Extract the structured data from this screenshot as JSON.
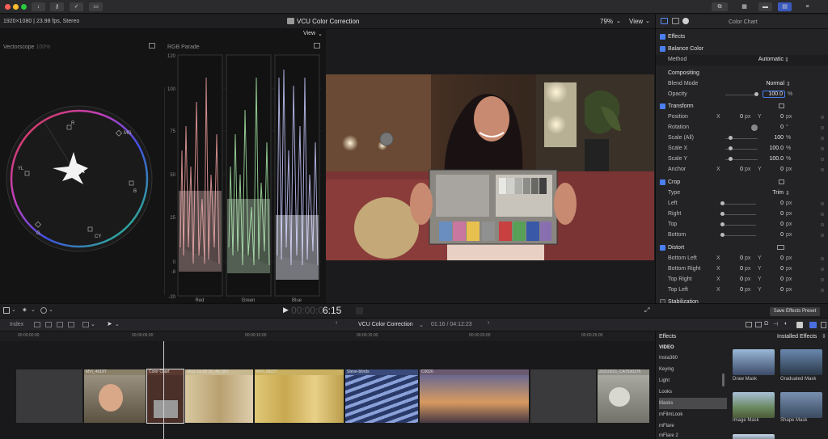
{
  "titlebar": {
    "colors": {
      "close": "#fe5f57",
      "minimize": "#febc2e",
      "zoom": "#28c840"
    },
    "left_buttons": [
      "download-icon",
      "key-icon",
      "check-icon",
      "message-icon"
    ],
    "right_buttons": [
      "clip-icon",
      "grid-icon",
      "browser-icon",
      "inspector-icon",
      "adjust-icon"
    ]
  },
  "viewer": {
    "format": "1920×1080 | 23.98 fps, Stereo",
    "title": "VCU Color Correction",
    "zoom": "79%",
    "view_label": "View",
    "scope_view_label": "View"
  },
  "scopes": {
    "vectorscope_label": "Vectorscope",
    "vectorscope_pct": "100%",
    "targets": [
      "R",
      "MG",
      "B",
      "CY",
      "G",
      "YL"
    ],
    "parade_label": "RGB Parade",
    "parade_ticks": [
      "120",
      "100",
      "75",
      "50",
      "25",
      "0",
      "-8",
      "-20"
    ],
    "parade_channels": [
      "Red",
      "Green",
      "Blue"
    ]
  },
  "inspector": {
    "title": "Color Chart",
    "effects_label": "Effects",
    "balance_color": "Balance Color",
    "method_label": "Method",
    "method_value": "Automatic",
    "compositing": "Compositing",
    "blend_mode_label": "Blend Mode",
    "blend_mode_value": "Normal",
    "opacity_label": "Opacity",
    "opacity_value": "100.0",
    "pct": "%",
    "transform": "Transform",
    "position_label": "Position",
    "rotation_label": "Rotation",
    "scale_all_label": "Scale (All)",
    "scale_x_label": "Scale X",
    "scale_y_label": "Scale Y",
    "anchor_label": "Anchor",
    "x": "X",
    "y": "Y",
    "px": "px",
    "deg": "°",
    "zero": "0",
    "hundred": "100",
    "hundred_dec": "100.0",
    "crop": "Crop",
    "type_label": "Type",
    "type_value": "Trim",
    "left_label": "Left",
    "right_label": "Right",
    "top_label": "Top",
    "bottom_label": "Bottom",
    "distort": "Distort",
    "bottom_left_label": "Bottom Left",
    "bottom_right_label": "Bottom Right",
    "top_right_label": "Top Right",
    "top_left_label": "Top Left",
    "stabilization": "Stabilization",
    "save_preset": "Save Effects Preset"
  },
  "transport": {
    "timecode_dim": "00:00:0",
    "timecode": "6:15"
  },
  "timeline": {
    "index_label": "Index",
    "project_title": "VCU Color Correction",
    "duration": "01:16 / 04:12:23",
    "ruler_ticks": [
      "00:00:00:00",
      "00:00:05:00",
      "00:00:10:00",
      "00:00:15:00",
      "00:00:20:00",
      "00:00:25:00"
    ],
    "clips": [
      "MVI_4619T",
      "Color Chart",
      "2011-10-20 22_44_56T",
      "MVI_0823T",
      "Steve-blinds",
      "C0026",
      "20210221_CA7530276"
    ]
  },
  "effects_browser": {
    "title": "Effects",
    "installed": "Installed Effects",
    "categories": [
      "VIDEO",
      "Insta360",
      "Keying",
      "Light",
      "Looks",
      "Masks",
      "mFilmLook",
      "mFlare",
      "mFlare 2"
    ],
    "selected": "Masks",
    "thumbs": [
      "Draw Mask",
      "Graduated Mask",
      "Image Mask",
      "Shape Mask"
    ]
  }
}
